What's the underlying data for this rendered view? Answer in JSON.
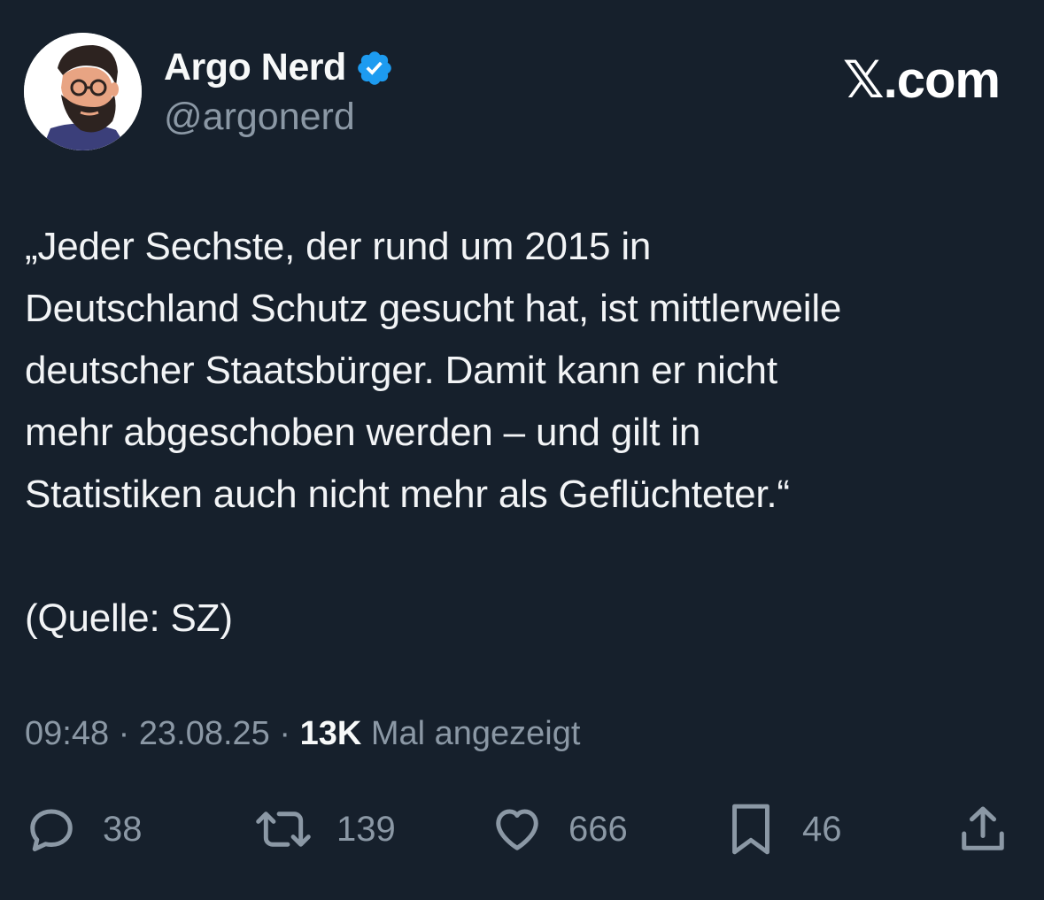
{
  "author": {
    "display_name": "Argo Nerd",
    "handle": "@argonerd",
    "verified": true,
    "avatar_icon": "bearded-man-avatar"
  },
  "brand": {
    "label": "𝕏.com"
  },
  "tweet": {
    "text": "„Jeder Sechste, der rund um 2015 in\nDeutschland Schutz gesucht hat, ist mittlerweile\ndeutscher Staatsbürger. Damit kann er nicht\nmehr abgeschoben werden – und gilt in\nStatistiken auch nicht mehr als Geflüchteter.“\n\n(Quelle: SZ)"
  },
  "meta": {
    "time": "09:48",
    "separator1": " · ",
    "date": "23.08.25",
    "separator2": " · ",
    "views_count": "13K",
    "views_label": " Mal angezeigt"
  },
  "actions": {
    "replies": {
      "icon": "reply-icon",
      "count": "38"
    },
    "reposts": {
      "icon": "repost-icon",
      "count": "139"
    },
    "likes": {
      "icon": "heart-icon",
      "count": "666"
    },
    "bookmarks": {
      "icon": "bookmark-icon",
      "count": "46"
    },
    "share": {
      "icon": "share-icon"
    }
  },
  "colors": {
    "background": "#16202c",
    "text_primary": "#f2f4f6",
    "text_secondary": "#8b98a5",
    "verified_badge": "#1d9bf0"
  }
}
